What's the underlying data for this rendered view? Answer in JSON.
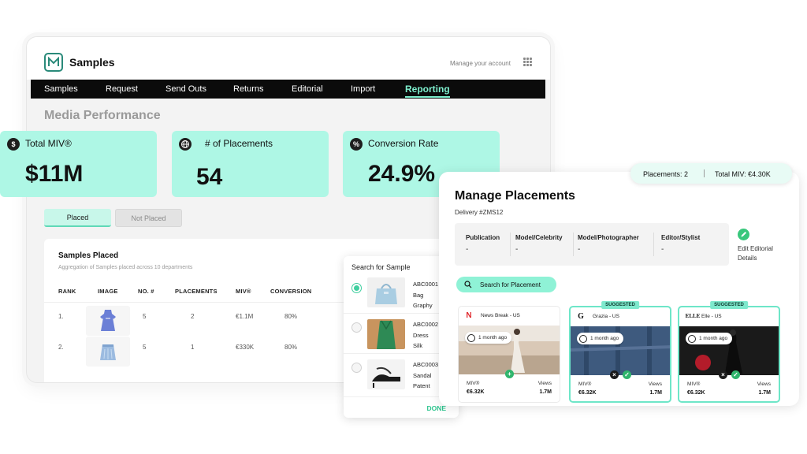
{
  "app": {
    "title": "Samples",
    "account_link": "Manage your account"
  },
  "nav": [
    "Samples",
    "Request",
    "Send Outs",
    "Returns",
    "Editorial",
    "Import",
    "Reporting"
  ],
  "nav_active": "Reporting",
  "section_title": "Media Performance",
  "kpis": [
    {
      "icon": "dollar-icon",
      "label": "Total MIV®",
      "value": "$11M"
    },
    {
      "icon": "globe-icon",
      "label": "# of Placements",
      "value": "54"
    },
    {
      "icon": "percent-icon",
      "label": "Conversion Rate",
      "value": "24.9%"
    }
  ],
  "toggles": {
    "placed": "Placed",
    "not_placed": "Not Placed"
  },
  "samples_table": {
    "title": "Samples Placed",
    "subtitle": "Aggregation of Samples placed across 10 departments",
    "columns": [
      "RANK",
      "IMAGE",
      "NO. #",
      "PLACEMENTS",
      "MIV®",
      "CONVERSION"
    ],
    "rows": [
      {
        "rank": "1.",
        "image": "dress-icon",
        "no": "5",
        "placements": "2",
        "miv": "€1.1M",
        "conversion": "80%"
      },
      {
        "rank": "2.",
        "image": "skirt-icon",
        "no": "5",
        "placements": "1",
        "miv": "€330K",
        "conversion": "80%"
      }
    ]
  },
  "sample_search": {
    "title": "Search for Sample",
    "items": [
      {
        "code": "ABC0001",
        "type": "Bag",
        "name": "Graphy",
        "selected": true
      },
      {
        "code": "ABC0002",
        "type": "Dress",
        "name": "Silk",
        "selected": false
      },
      {
        "code": "ABC0003",
        "type": "Sandal",
        "name": "Patent",
        "selected": false
      }
    ],
    "done": "DONE"
  },
  "summary": {
    "placements": "Placements: 2",
    "miv": "Total MIV: €4.30K"
  },
  "manage": {
    "title": "Manage Placements",
    "delivery": "Delivery #ZMS12",
    "fields": [
      {
        "label": "Publication",
        "value": "-"
      },
      {
        "label": "Model/Celebrity",
        "value": "-"
      },
      {
        "label": "Model/Photographer",
        "value": "-"
      },
      {
        "label": "Editor/Stylist",
        "value": "-"
      }
    ],
    "edit_label_1": "Edit Editorial",
    "edit_label_2": "Details",
    "search_button": "Search for Placement",
    "cards": [
      {
        "badge": "",
        "logo": "N",
        "source": "News Break - US",
        "time": "1 month ago",
        "miv_label": "MIV®",
        "miv": "€6.32K",
        "views_label": "Views",
        "views": "1.7M"
      },
      {
        "badge": "SUGGESTED",
        "logo": "G",
        "source": "Grazia - US",
        "time": "1 month ago",
        "miv_label": "MIV®",
        "miv": "€6.32K",
        "views_label": "Views",
        "views": "1.7M"
      },
      {
        "badge": "SUGGESTED",
        "logo": "ELLE",
        "source": "Elle - US",
        "time": "1 month ago",
        "miv_label": "MIV®",
        "miv": "€6.32K",
        "views_label": "Views",
        "views": "1.7M"
      }
    ]
  },
  "colors": {
    "accent": "#aef7e5",
    "accent_dark": "#2fc58f",
    "nav_bg": "#0b0b0b",
    "nav_active": "#7ff0cf"
  }
}
